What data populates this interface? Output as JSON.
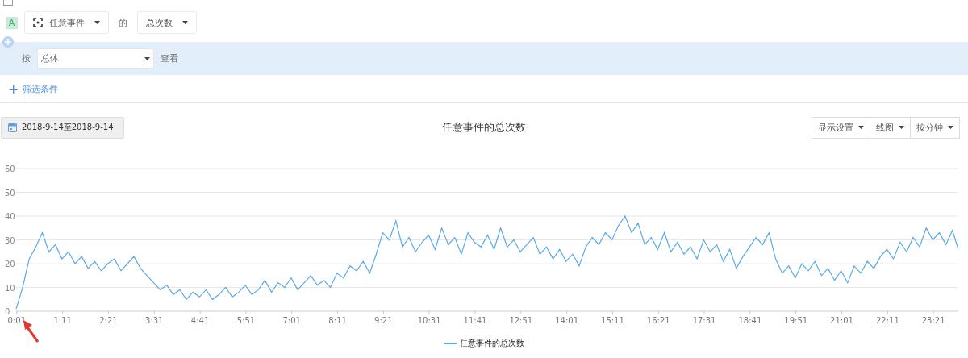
{
  "hidden_option": {
    "checked": false
  },
  "metric": {
    "badge": "A",
    "event": "任意事件",
    "of": "的",
    "measure": "总次数"
  },
  "group_by": {
    "prefix": "按",
    "value": "总体",
    "suffix": "查看"
  },
  "filter": {
    "icon": "+",
    "label": "筛选条件"
  },
  "date_range": "2018-9-14至2018-9-14",
  "title": "任意事件的总次数",
  "view_buttons": [
    "显示设置",
    "线图",
    "按分钟"
  ],
  "chart_data": {
    "type": "line",
    "grid": true,
    "xlim": [
      0,
      1439
    ],
    "ylim": [
      0,
      60
    ],
    "yticks": [
      0,
      10,
      20,
      30,
      40,
      50,
      60
    ],
    "xticks": [
      {
        "value": 1,
        "label": "0:01"
      },
      {
        "value": 71,
        "label": "1:11"
      },
      {
        "value": 141,
        "label": "2:21"
      },
      {
        "value": 211,
        "label": "3:31"
      },
      {
        "value": 281,
        "label": "4:41"
      },
      {
        "value": 351,
        "label": "5:51"
      },
      {
        "value": 421,
        "label": "7:01"
      },
      {
        "value": 491,
        "label": "8:11"
      },
      {
        "value": 561,
        "label": "9:21"
      },
      {
        "value": 631,
        "label": "10:31"
      },
      {
        "value": 701,
        "label": "11:41"
      },
      {
        "value": 771,
        "label": "12:51"
      },
      {
        "value": 841,
        "label": "14:01"
      },
      {
        "value": 911,
        "label": "15:11"
      },
      {
        "value": 981,
        "label": "16:21"
      },
      {
        "value": 1051,
        "label": "17:31"
      },
      {
        "value": 1121,
        "label": "18:41"
      },
      {
        "value": 1191,
        "label": "19:51"
      },
      {
        "value": 1261,
        "label": "21:01"
      },
      {
        "value": 1331,
        "label": "22:11"
      },
      {
        "value": 1401,
        "label": "23:21"
      }
    ],
    "x": [
      0,
      10,
      20,
      30,
      40,
      50,
      60,
      70,
      80,
      90,
      100,
      110,
      120,
      130,
      140,
      150,
      160,
      170,
      180,
      190,
      200,
      210,
      220,
      230,
      240,
      250,
      260,
      270,
      280,
      290,
      300,
      310,
      320,
      330,
      340,
      350,
      360,
      370,
      380,
      390,
      400,
      410,
      420,
      430,
      440,
      450,
      460,
      470,
      480,
      490,
      500,
      510,
      520,
      530,
      540,
      550,
      560,
      570,
      580,
      590,
      600,
      610,
      620,
      630,
      640,
      650,
      660,
      670,
      680,
      690,
      700,
      710,
      720,
      730,
      740,
      750,
      760,
      770,
      780,
      790,
      800,
      810,
      820,
      830,
      840,
      850,
      860,
      870,
      880,
      890,
      900,
      910,
      920,
      930,
      940,
      950,
      960,
      970,
      980,
      990,
      1000,
      1010,
      1020,
      1030,
      1040,
      1050,
      1060,
      1070,
      1080,
      1090,
      1100,
      1110,
      1120,
      1130,
      1140,
      1150,
      1160,
      1170,
      1180,
      1190,
      1200,
      1210,
      1220,
      1230,
      1240,
      1250,
      1260,
      1270,
      1280,
      1290,
      1300,
      1310,
      1320,
      1330,
      1340,
      1350,
      1360,
      1370,
      1380,
      1390,
      1400,
      1410,
      1420,
      1430,
      1439
    ],
    "series": [
      {
        "name": "任意事件的总次数",
        "color": "#5aaae8",
        "values": [
          1,
          10,
          22,
          27,
          33,
          25,
          28,
          22,
          25,
          20,
          23,
          18,
          21,
          17,
          20,
          22,
          17,
          20,
          23,
          18,
          15,
          12,
          9,
          11,
          7,
          9,
          5,
          8,
          6,
          9,
          5,
          7,
          10,
          6,
          8,
          11,
          7,
          9,
          13,
          8,
          12,
          10,
          14,
          9,
          12,
          15,
          11,
          13,
          10,
          16,
          14,
          19,
          17,
          21,
          16,
          24,
          33,
          30,
          38,
          27,
          31,
          25,
          29,
          32,
          26,
          35,
          28,
          31,
          24,
          33,
          29,
          27,
          32,
          26,
          35,
          27,
          30,
          25,
          28,
          31,
          24,
          27,
          22,
          26,
          21,
          24,
          19,
          27,
          31,
          28,
          33,
          30,
          36,
          40,
          33,
          37,
          28,
          31,
          26,
          33,
          25,
          29,
          24,
          27,
          22,
          30,
          25,
          28,
          21,
          26,
          18,
          23,
          27,
          31,
          28,
          33,
          22,
          16,
          19,
          14,
          20,
          17,
          21,
          15,
          18,
          13,
          17,
          12,
          19,
          16,
          21,
          18,
          23,
          26,
          22,
          29,
          25,
          31,
          27,
          35,
          30,
          33,
          28,
          34,
          26
        ]
      }
    ]
  }
}
